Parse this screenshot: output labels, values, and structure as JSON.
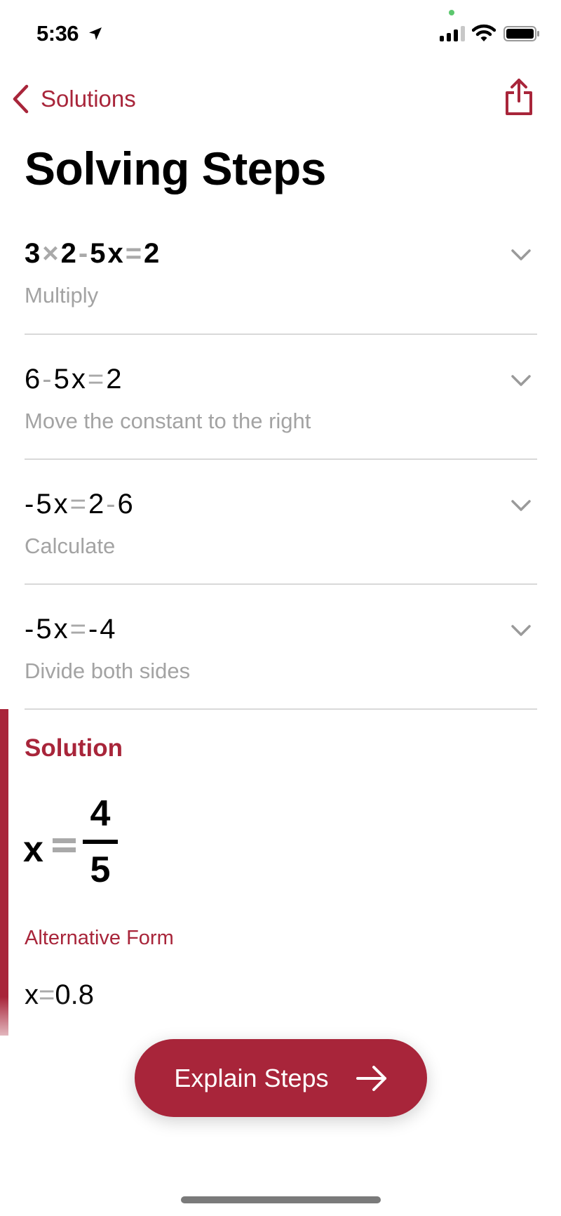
{
  "status_bar": {
    "time": "5:36",
    "location_icon": "location-arrow-icon",
    "signal_icon": "cellular-signal-icon",
    "wifi_icon": "wifi-icon",
    "battery_icon": "battery-full-icon"
  },
  "nav": {
    "back_label": "Solutions",
    "back_icon": "chevron-left-icon",
    "share_icon": "share-icon"
  },
  "page_title": "Solving Steps",
  "steps": [
    {
      "tokens": [
        {
          "t": "3",
          "op": false
        },
        {
          "t": "×",
          "op": true
        },
        {
          "t": "2",
          "op": false
        },
        {
          "t": "-",
          "op": true
        },
        {
          "t": "5",
          "op": false
        },
        {
          "t": "x",
          "op": false
        },
        {
          "t": "=",
          "op": true
        },
        {
          "t": "2",
          "op": false
        }
      ],
      "equation": "3×2-5x=2",
      "description": "Multiply",
      "bold": true
    },
    {
      "tokens": [
        {
          "t": "6",
          "op": false
        },
        {
          "t": "-",
          "op": true
        },
        {
          "t": "5",
          "op": false
        },
        {
          "t": "x",
          "op": false
        },
        {
          "t": "=",
          "op": true
        },
        {
          "t": "2",
          "op": false
        }
      ],
      "equation": "6-5x=2",
      "description": "Move the constant to the right",
      "bold": false
    },
    {
      "tokens": [
        {
          "t": "-",
          "op": false
        },
        {
          "t": "5",
          "op": false
        },
        {
          "t": "x",
          "op": false
        },
        {
          "t": "=",
          "op": true
        },
        {
          "t": "2",
          "op": false
        },
        {
          "t": "-",
          "op": true
        },
        {
          "t": "6",
          "op": false
        }
      ],
      "equation": "-5x=2-6",
      "description": "Calculate",
      "bold": false
    },
    {
      "tokens": [
        {
          "t": "-",
          "op": false
        },
        {
          "t": "5",
          "op": false
        },
        {
          "t": "x",
          "op": false
        },
        {
          "t": "=",
          "op": true
        },
        {
          "t": "-",
          "op": false
        },
        {
          "t": "4",
          "op": false
        }
      ],
      "equation": "-5x=-4",
      "description": "Divide both sides",
      "bold": false
    }
  ],
  "solution": {
    "heading": "Solution",
    "variable": "x",
    "numerator": "4",
    "denominator": "5",
    "alternative_label": "Alternative Form",
    "alternative_variable": "x",
    "alternative_equals": "=",
    "alternative_value": "0.8"
  },
  "explain_button": {
    "label": "Explain Steps",
    "icon": "arrow-right-icon"
  },
  "colors": {
    "accent": "#a8253a",
    "operator_gray": "#a9a9a9",
    "description_gray": "#a3a3a3",
    "divider": "#d9d9d9"
  }
}
